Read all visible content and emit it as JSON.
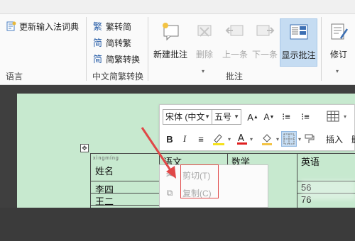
{
  "ribbon": {
    "lang_group": {
      "update_ime_label": "更新输入法词典",
      "group_label": "语言"
    },
    "conversion_group": {
      "to_simplified_label": "繁转简",
      "to_traditional_label": "简转繁",
      "convert_label": "简繁转换",
      "group_label": "中文简繁转换"
    },
    "comments_group": {
      "new_comment_label": "新建批注",
      "delete_label": "删除",
      "previous_label": "上一条",
      "next_label": "下一条",
      "show_comments_label": "显示批注",
      "group_label": "批注"
    },
    "tracking_group": {
      "track_changes_label": "修订"
    }
  },
  "mini_toolbar": {
    "font_name": "宋体 (中文",
    "font_size": "五号",
    "bold_label": "B",
    "italic_label": "I",
    "insert_label": "插入",
    "delete_label": "删除"
  },
  "table": {
    "headers": [
      "姓名",
      "语文",
      "数学",
      "英语"
    ],
    "rows": [
      [
        "李四",
        "",
        "",
        "56"
      ],
      [
        "王二",
        "",
        "",
        "76"
      ]
    ]
  },
  "context_menu": {
    "items": [
      {
        "label": "剪切(T)",
        "icon": "scissors-icon",
        "enabled": false
      },
      {
        "label": "复制(C)",
        "icon": "copy-icon",
        "enabled": false
      }
    ]
  },
  "colors": {
    "page_bg": "#c7e9cf",
    "highlight_box": "#e04848",
    "arrow": "#e04848",
    "active_button": "#c5dcf2"
  }
}
